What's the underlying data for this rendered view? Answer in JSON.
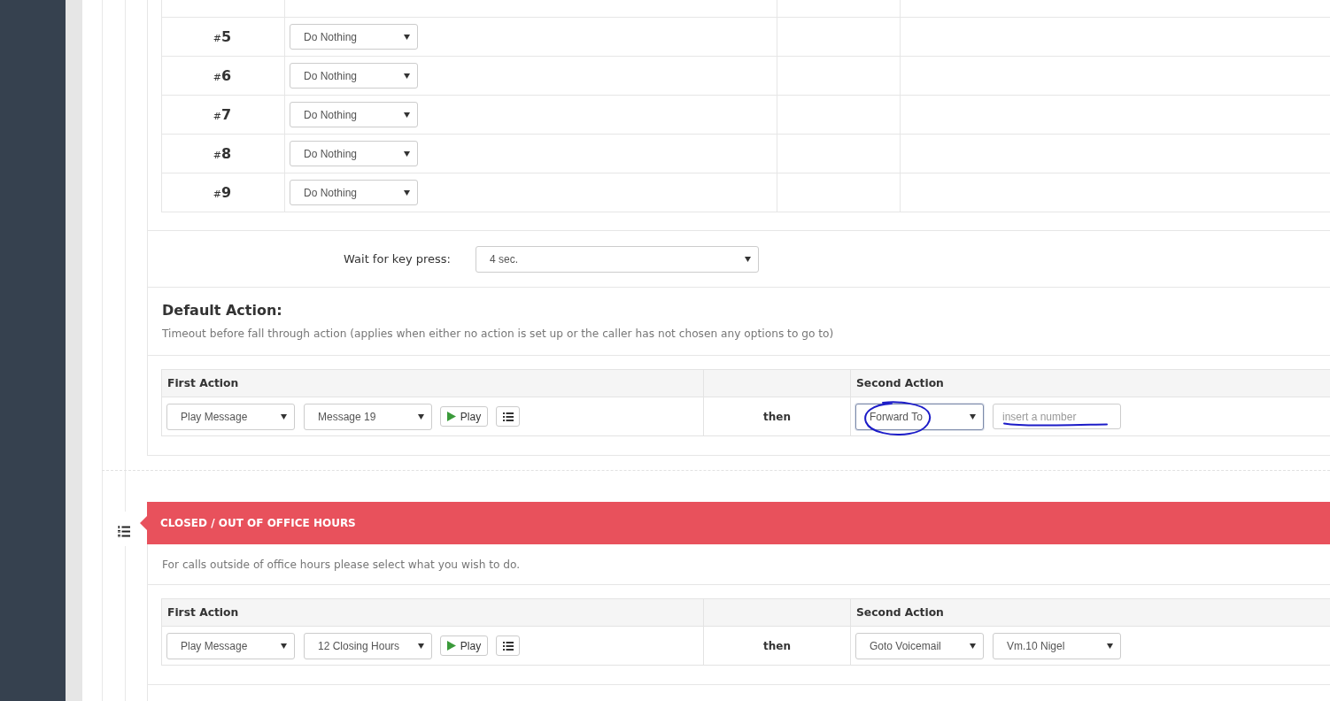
{
  "keypad": {
    "rows": [
      {
        "prefix": "#",
        "key": "5",
        "action": "Do Nothing"
      },
      {
        "prefix": "#",
        "key": "6",
        "action": "Do Nothing"
      },
      {
        "prefix": "#",
        "key": "7",
        "action": "Do Nothing"
      },
      {
        "prefix": "#",
        "key": "8",
        "action": "Do Nothing"
      },
      {
        "prefix": "#",
        "key": "9",
        "action": "Do Nothing"
      }
    ]
  },
  "wait_for_key_press": {
    "label": "Wait for key press:",
    "value": "4 sec."
  },
  "default_action": {
    "title": "Default Action:",
    "description": "Timeout before fall through action (applies when either no action is set up or the caller has not chosen any options to go to)",
    "table": {
      "headers": {
        "first": "First Action",
        "second": "Second Action"
      },
      "first_action": [
        {
          "kind": "select",
          "value": "Play Message",
          "focused": false
        },
        {
          "kind": "select",
          "value": "Message 19",
          "focused": false
        },
        {
          "kind": "play",
          "label": "Play"
        },
        {
          "kind": "list"
        }
      ],
      "connector": "then",
      "second_action": [
        {
          "kind": "select",
          "value": "Forward To",
          "focused": true,
          "ink_circled": true
        },
        {
          "kind": "input",
          "placeholder": "insert a number",
          "ink_underlined": true
        }
      ]
    }
  },
  "closed_hours": {
    "title": "CLOSED / OUT OF OFFICE HOURS",
    "description": "For calls outside of office hours please select what you wish to do.",
    "table": {
      "headers": {
        "first": "First Action",
        "second": "Second Action"
      },
      "first_action": [
        {
          "kind": "select",
          "value": "Play Message",
          "focused": false
        },
        {
          "kind": "select",
          "value": "12 Closing Hours",
          "focused": false
        },
        {
          "kind": "play",
          "label": "Play"
        },
        {
          "kind": "list"
        }
      ],
      "connector": "then",
      "second_action": [
        {
          "kind": "select",
          "value": "Goto Voicemail",
          "focused": false
        },
        {
          "kind": "select",
          "value": "Vm.10 Nigel",
          "focused": false
        }
      ]
    }
  }
}
